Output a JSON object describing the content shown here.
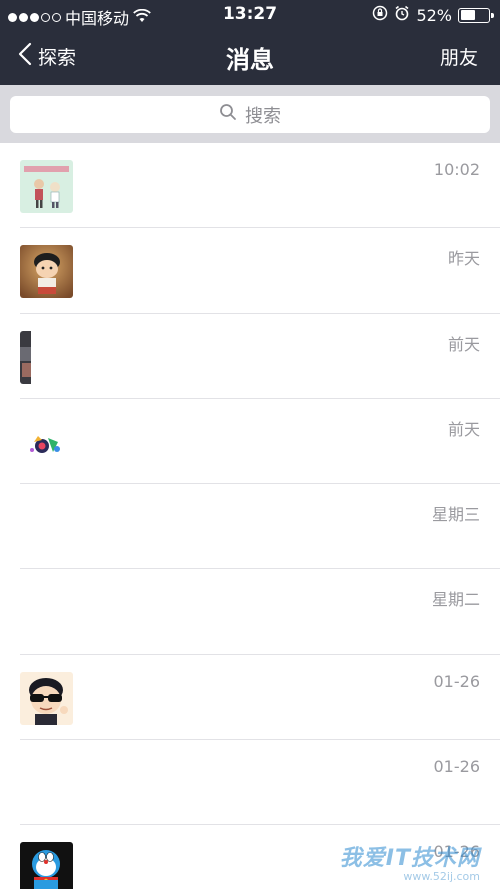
{
  "status_bar": {
    "carrier": "中国移动",
    "time": "13:27",
    "battery_percent": "52%",
    "battery_level": 0.52,
    "icons": [
      "signal-dots-icon",
      "wifi-icon",
      "rotation-lock-icon",
      "alarm-icon",
      "battery-icon"
    ]
  },
  "nav": {
    "back_label": "探索",
    "title": "消息",
    "right_label": "朋友"
  },
  "search": {
    "placeholder": "搜索"
  },
  "messages": [
    {
      "time": "10:02",
      "avatar": "comic-couple-avatar"
    },
    {
      "time": "昨天",
      "avatar": "cartoon-boy-avatar"
    },
    {
      "time": "前天",
      "avatar": "dark-photo-avatar"
    },
    {
      "time": "前天",
      "avatar": "colorful-logo-avatar"
    },
    {
      "time": "星期三",
      "avatar": ""
    },
    {
      "time": "星期二",
      "avatar": ""
    },
    {
      "time": "01-26",
      "avatar": "sunglasses-cartoon-avatar"
    },
    {
      "time": "01-26",
      "avatar": ""
    },
    {
      "time": "01-26",
      "avatar": "doraemon-avatar"
    }
  ],
  "watermark": {
    "text": "我爱IT技术网",
    "url": "www.52ij.com"
  },
  "colors": {
    "header_bg": "#2a2e3b",
    "search_area_bg": "#d9d9de",
    "time_text": "#9a9a9f",
    "divider": "#e2e2e6"
  }
}
